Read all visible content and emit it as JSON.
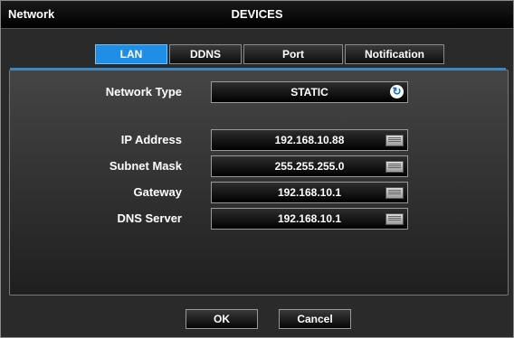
{
  "window": {
    "app_name": "Network",
    "title": "DEVICES"
  },
  "tabs": [
    {
      "label": "LAN",
      "active": true
    },
    {
      "label": "DDNS",
      "active": false
    },
    {
      "label": "Port",
      "active": false
    },
    {
      "label": "Notification",
      "active": false
    }
  ],
  "network_type": {
    "label": "Network Type",
    "value": "STATIC",
    "icon": "refresh-icon"
  },
  "fields": [
    {
      "label": "IP Address",
      "value": "192.168.10.88",
      "icon": "keyboard-icon"
    },
    {
      "label": "Subnet Mask",
      "value": "255.255.255.0",
      "icon": "keyboard-icon"
    },
    {
      "label": "Gateway",
      "value": "192.168.10.1",
      "icon": "keyboard-icon"
    },
    {
      "label": "DNS Server",
      "value": "192.168.10.1",
      "icon": "keyboard-icon"
    }
  ],
  "buttons": {
    "ok": "OK",
    "cancel": "Cancel"
  },
  "colors": {
    "accent": "#1f8ee6",
    "panel": "#2a2a2a"
  }
}
